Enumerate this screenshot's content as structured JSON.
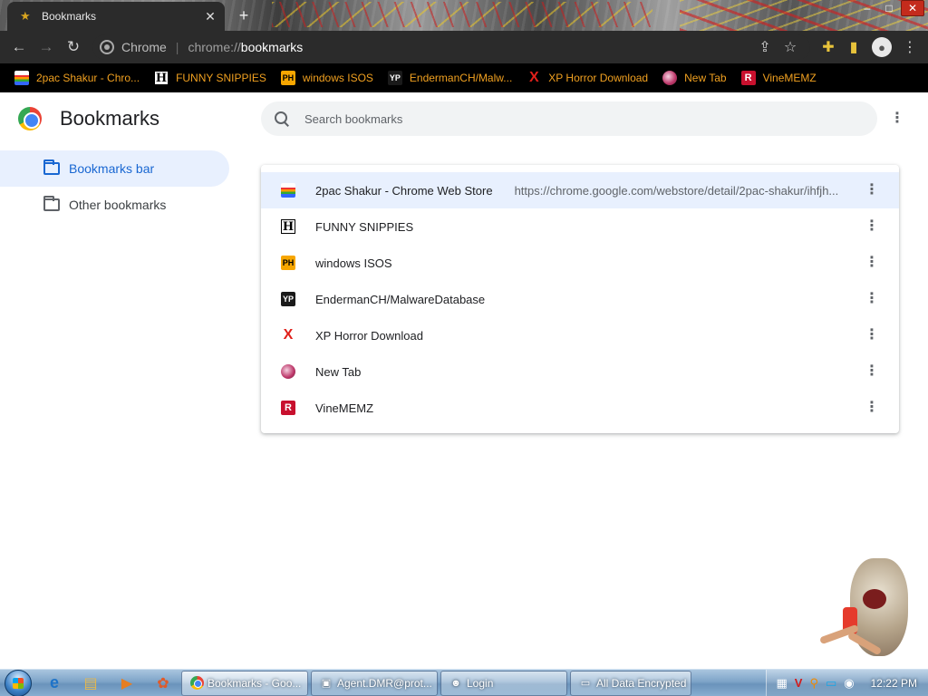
{
  "window": {
    "tab_title": "Bookmarks",
    "tab_close": "✕",
    "new_tab": "+",
    "controls": {
      "minimize": "–",
      "maximize": "□",
      "close": "✕"
    }
  },
  "toolbar": {
    "omnibox_label": "Chrome",
    "url_scheme": "chrome://",
    "url_host": "bookmarks"
  },
  "bookmarks_bar": [
    {
      "label": "2pac Shakur - Chro...",
      "icon": "ico-store",
      "glyph": ""
    },
    {
      "label": "FUNNY SNIPPIES",
      "icon": "ico-h",
      "glyph": "H"
    },
    {
      "label": "windows ISOS",
      "icon": "ico-ph",
      "glyph": "PH"
    },
    {
      "label": "EndermanCH/Malw...",
      "icon": "ico-yp",
      "glyph": "YP"
    },
    {
      "label": "XP Horror Download",
      "icon": "ico-x",
      "glyph": "X"
    },
    {
      "label": "New Tab",
      "icon": "ico-globe",
      "glyph": ""
    },
    {
      "label": "VineMEMZ",
      "icon": "ico-r",
      "glyph": "R"
    }
  ],
  "page": {
    "title": "Bookmarks",
    "search_placeholder": "Search bookmarks"
  },
  "sidebar": {
    "items": [
      {
        "label": "Bookmarks bar",
        "active": true
      },
      {
        "label": "Other bookmarks",
        "active": false
      }
    ]
  },
  "list": {
    "rows": [
      {
        "title": "2pac Shakur - Chrome Web Store",
        "url": "https://chrome.google.com/webstore/detail/2pac-shakur/ihfjh...",
        "icon": "ico-store",
        "glyph": "",
        "selected": true
      },
      {
        "title": "FUNNY SNIPPIES",
        "url": "",
        "icon": "ico-h",
        "glyph": "H",
        "selected": false
      },
      {
        "title": "windows ISOS",
        "url": "",
        "icon": "ico-ph",
        "glyph": "PH",
        "selected": false
      },
      {
        "title": "EndermanCH/MalwareDatabase",
        "url": "",
        "icon": "ico-yp",
        "glyph": "YP",
        "selected": false
      },
      {
        "title": "XP Horror Download",
        "url": "",
        "icon": "ico-x",
        "glyph": "X",
        "selected": false
      },
      {
        "title": "New Tab",
        "url": "",
        "icon": "ico-globe",
        "glyph": "",
        "selected": false
      },
      {
        "title": "VineMEMZ",
        "url": "",
        "icon": "ico-r",
        "glyph": "R",
        "selected": false
      }
    ]
  },
  "taskbar": {
    "tasks": [
      {
        "label": "Bookmarks - Goo...",
        "icon": "chrome",
        "active": true
      },
      {
        "label": "Agent.DMR@prot...",
        "icon": "window",
        "active": false
      },
      {
        "label": "Login",
        "icon": "user",
        "active": false
      },
      {
        "label": "All Data Encrypted",
        "icon": "window",
        "active": false
      }
    ],
    "clock": "12:22 PM"
  },
  "colors": {
    "accent": "#1967d2",
    "selected_bg": "#e8f0fe",
    "bookmark_text": "#f0a020"
  }
}
